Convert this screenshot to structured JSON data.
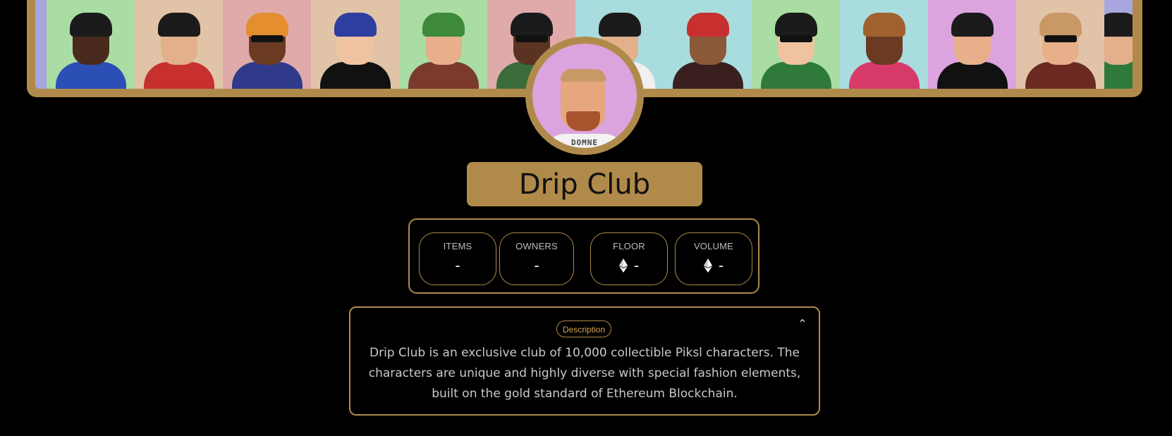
{
  "collection": {
    "name": "Drip Club",
    "avatar_shirt_text": "DOMNE"
  },
  "banner": {
    "tiles": [
      {
        "bg": "#a8a6de",
        "skin": "#e3b08b",
        "hair": "#2b1a12",
        "body": "#3a62c8",
        "narrow": true
      },
      {
        "bg": "#a9dda3",
        "skin": "#4a2a1c",
        "hair": "#1b1b1b",
        "body": "#2c4fb5"
      },
      {
        "bg": "#e1c4a8",
        "skin": "#e3b08b",
        "hair": "#1b1b1b",
        "body": "#c7302f"
      },
      {
        "bg": "#e0aaaa",
        "skin": "#6b3a22",
        "hair": "#e48e2f",
        "body": "#2f3a8a"
      },
      {
        "bg": "#e1c4a8",
        "skin": "#f0c3a0",
        "hair": "#2d3ea0",
        "body": "#111111"
      },
      {
        "bg": "#a9dda3",
        "skin": "#e7b08a",
        "hair": "#3d8a3b",
        "body": "#7a3a2e"
      },
      {
        "bg": "#e0aaaa",
        "skin": "#5a3322",
        "hair": "#1b1b1b",
        "body": "#3a6b3a"
      },
      {
        "bg": "#a9dcde",
        "skin": "#e3b08b",
        "hair": "#1b1b1b",
        "body": "#f0f0f0"
      },
      {
        "bg": "#a9dcde",
        "skin": "#8a5a3a",
        "hair": "#c7302f",
        "body": "#3a1f1f"
      },
      {
        "bg": "#a9dda3",
        "skin": "#f0c3a0",
        "hair": "#1b1b1b",
        "body": "#2f7a3a"
      },
      {
        "bg": "#a9dcde",
        "skin": "#6b3a22",
        "hair": "#a0612e",
        "body": "#d83b6a"
      },
      {
        "bg": "#dca4de",
        "skin": "#e7b08a",
        "hair": "#1b1b1b",
        "body": "#111111"
      },
      {
        "bg": "#e1c4a8",
        "skin": "#e7b08a",
        "hair": "#c99867",
        "body": "#6a2a22"
      },
      {
        "bg": "#a8a6de",
        "skin": "#e3b08b",
        "hair": "#1b1b1b",
        "body": "#2f7a3a",
        "end": true
      }
    ]
  },
  "stats": [
    {
      "label": "ITEMS",
      "value": "-",
      "icon": ""
    },
    {
      "label": "OWNERS",
      "value": "-",
      "icon": ""
    },
    {
      "label": "FLOOR",
      "value": "-",
      "icon": "ethereum-icon"
    },
    {
      "label": "VOLUME",
      "value": "-",
      "icon": "ethereum-icon"
    }
  ],
  "description": {
    "badge": "Description",
    "toggle_icon": "chevron-up-icon",
    "text": "Drip Club is an exclusive club of 10,000 collectible Piksl characters. The characters are unique and highly diverse with special fashion elements, built on the gold standard of Ethereum Blockchain."
  },
  "colors": {
    "accent": "#b08a4a",
    "badge_text": "#d7a253",
    "background": "#000000"
  }
}
